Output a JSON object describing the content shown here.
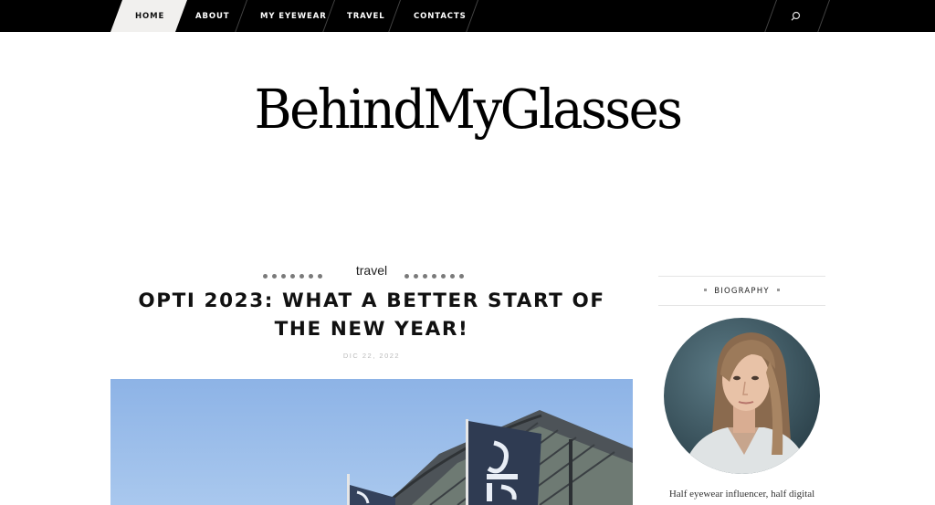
{
  "nav": {
    "items": [
      {
        "label": "HOME"
      },
      {
        "label": "ABOUT"
      },
      {
        "label": "MY EYEWEAR"
      },
      {
        "label": "TRAVEL"
      },
      {
        "label": "CONTACTS"
      }
    ],
    "search_icon": "search-icon"
  },
  "site": {
    "logo": "BehindMyGlasses"
  },
  "post": {
    "category": "travel",
    "title": "OPTI 2023: WHAT A BETTER START OF THE NEW YEAR!",
    "date": "DIC 22, 2022"
  },
  "sidebar": {
    "biography_title": "BIOGRAPHY",
    "bio_text": "Half eyewear influencer, half digital"
  },
  "colors": {
    "nav_bg": "#000000",
    "active_tab_bg": "#f1f0ee",
    "sky": "#8fb6e8"
  }
}
